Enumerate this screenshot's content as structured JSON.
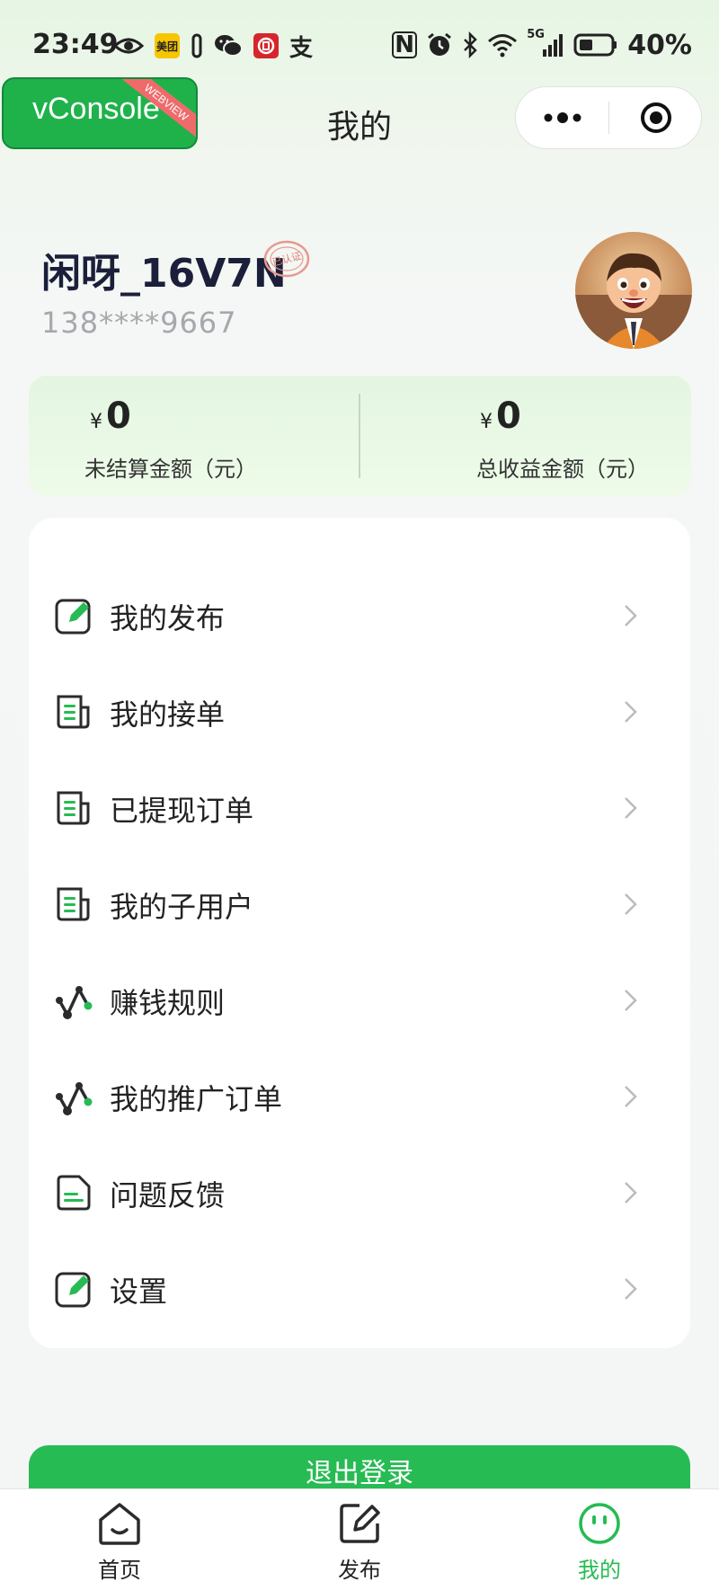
{
  "status_bar": {
    "time": "23:49",
    "battery": "40%",
    "signal_label": "5G",
    "meituan_label": "美团",
    "alipay_label": "支",
    "nfc_label": "N"
  },
  "vconsole": {
    "label": "vConsole",
    "ribbon": "WEBVIEW"
  },
  "header": {
    "title": "我的"
  },
  "profile": {
    "nickname": "闲呀_16V7N",
    "verified_label": "已认证",
    "phone": "138****9667"
  },
  "earnings": {
    "currency": "¥",
    "unsettled": {
      "value": "0",
      "label": "未结算金额（元）"
    },
    "total": {
      "value": "0",
      "label": "总收益金额（元）"
    }
  },
  "menu": {
    "items": [
      {
        "label": "我的发布",
        "icon": "edit-icon"
      },
      {
        "label": "我的接单",
        "icon": "document-icon"
      },
      {
        "label": "已提现订单",
        "icon": "document-icon"
      },
      {
        "label": "我的子用户",
        "icon": "document-icon"
      },
      {
        "label": "赚钱规则",
        "icon": "trend-icon"
      },
      {
        "label": "我的推广订单",
        "icon": "trend-icon"
      },
      {
        "label": "问题反馈",
        "icon": "feedback-icon"
      },
      {
        "label": "设置",
        "icon": "edit-icon"
      }
    ]
  },
  "logout": {
    "label": "退出登录"
  },
  "tabbar": {
    "tabs": [
      {
        "label": "首页",
        "icon": "home-icon",
        "active": false
      },
      {
        "label": "发布",
        "icon": "edit-icon",
        "active": false
      },
      {
        "label": "我的",
        "icon": "face-icon",
        "active": true
      }
    ]
  },
  "colors": {
    "accent": "#27bb53",
    "vconsole": "#1fb24b",
    "card_tint": "#e3f6e1"
  }
}
